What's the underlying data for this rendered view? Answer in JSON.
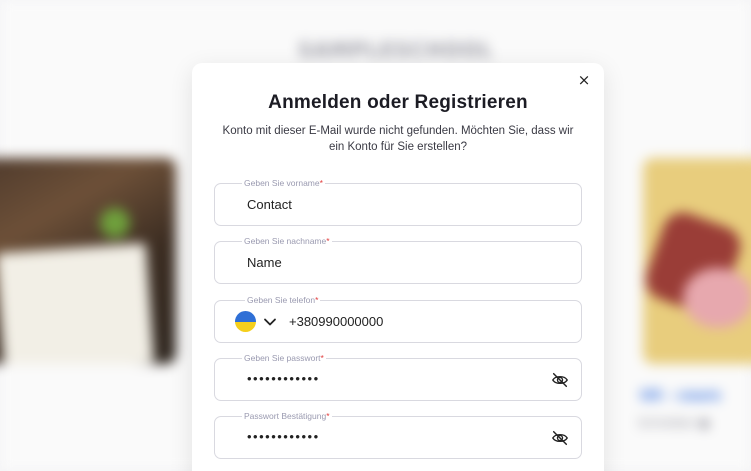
{
  "background": {
    "title": "SAMPLESCHOOL",
    "right_link": "UX - cours",
    "right_meta": "Schreiber  ●"
  },
  "modal": {
    "title": "Anmelden oder Registrieren",
    "subtitle": "Konto mit dieser E-Mail wurde nicht gefunden. Möchten Sie, dass wir ein Konto für Sie erstellen?",
    "close_icon": "×"
  },
  "fields": {
    "first_name": {
      "label": "Geben Sie vorname",
      "value": "Contact"
    },
    "last_name": {
      "label": "Geben Sie nachname",
      "value": "Name"
    },
    "phone": {
      "label": "Geben Sie telefon",
      "value": "+380990000000",
      "country_flag": "ukraine-flag-icon"
    },
    "password": {
      "label": "Geben Sie passwort",
      "value": "••••••••••••"
    },
    "password_confirm": {
      "label": "Passwort Bestätigung",
      "value": "••••••••••••"
    }
  },
  "required_mark": "*",
  "colors": {
    "required": "#e23b3b",
    "flag_blue": "#2f6fd6",
    "flag_yellow": "#f5cf1c"
  }
}
